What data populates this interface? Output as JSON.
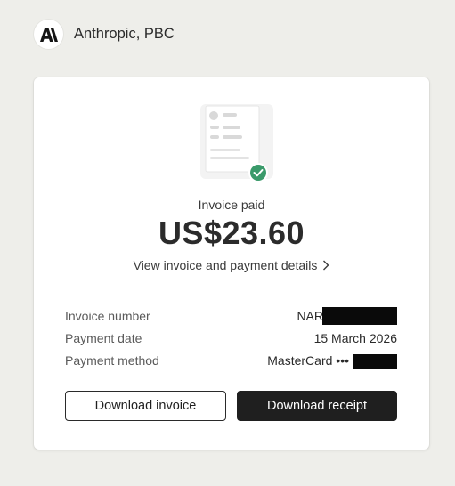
{
  "header": {
    "company": "Anthropic, PBC",
    "logo_icon": "anthropic-logo"
  },
  "invoice": {
    "status_label": "Invoice paid",
    "amount": "US$23.60",
    "view_link": "View invoice and payment details",
    "status_color": "#3a9a6a"
  },
  "details": [
    {
      "label": "Invoice number",
      "value": "NAR"
    },
    {
      "label": "Payment date",
      "value": "15 March 2026"
    },
    {
      "label": "Payment method",
      "value": "MasterCard •••"
    }
  ],
  "actions": {
    "download_invoice": "Download invoice",
    "download_receipt": "Download receipt"
  }
}
